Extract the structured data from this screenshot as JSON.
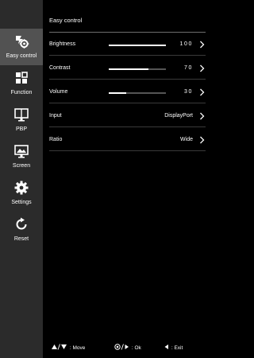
{
  "sidebar": {
    "items": [
      {
        "label": "Easy control",
        "icon": "easy-control-icon",
        "active": true
      },
      {
        "label": "Function",
        "icon": "function-grid-icon",
        "active": false
      },
      {
        "label": "PBP",
        "icon": "pbp-icon",
        "active": false
      },
      {
        "label": "Screen",
        "icon": "screen-icon",
        "active": false
      },
      {
        "label": "Settings",
        "icon": "gear-icon",
        "active": false
      },
      {
        "label": "Reset",
        "icon": "reset-icon",
        "active": false
      }
    ]
  },
  "main": {
    "title": "Easy control",
    "rows": [
      {
        "label": "Brightness",
        "value": "100",
        "level": 1.0
      },
      {
        "label": "Contrast",
        "value": "70",
        "level": 0.7
      },
      {
        "label": "Volume",
        "value": "30",
        "level": 0.3
      },
      {
        "label": "Input",
        "value": "DisplayPort"
      },
      {
        "label": "Ratio",
        "value": "Wide"
      }
    ]
  },
  "footer": {
    "move_label": "Move",
    "ok_label": "Ok",
    "exit_label": "Exit",
    "separator": ":"
  },
  "colors": {
    "background": "#000000",
    "sidebar": "#2b2b2b",
    "sidebar_active": "#525252",
    "text": "#ffffff"
  }
}
